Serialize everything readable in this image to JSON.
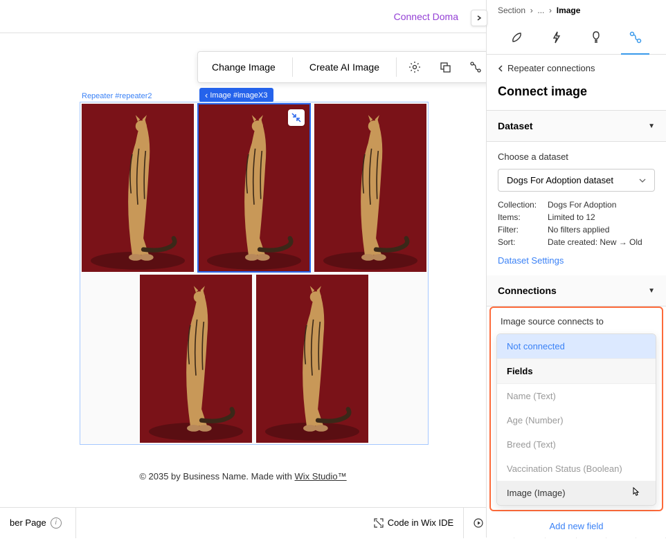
{
  "header": {
    "connect_domain": "Connect Doma"
  },
  "toolbar": {
    "change_image": "Change Image",
    "create_ai_image": "Create AI Image"
  },
  "canvas": {
    "repeater_label": "Repeater #repeater2",
    "image_tag": "Image #imageX3"
  },
  "footer": {
    "prefix": "© 2035 by Business Name. Made with ",
    "link": "Wix Studio™"
  },
  "bottom": {
    "page": "ber Page",
    "code_ide": "Code in Wix IDE",
    "run": "Run"
  },
  "panel": {
    "breadcrumb": {
      "a": "Section",
      "sep": "›",
      "mid": "...",
      "current": "Image"
    },
    "back": "Repeater connections",
    "title": "Connect image",
    "dataset_header": "Dataset",
    "choose_dataset": "Choose a dataset",
    "dataset_value": "Dogs For Adoption dataset",
    "meta": {
      "collection_k": "Collection:",
      "collection_v": "Dogs For Adoption",
      "items_k": "Items:",
      "items_v": "Limited to 12",
      "filter_k": "Filter:",
      "filter_v": "No filters applied",
      "sort_k": "Sort:",
      "sort_v": "Date created: New → Old"
    },
    "dataset_settings": "Dataset Settings",
    "connections_header": "Connections",
    "image_connects": "Image source connects to",
    "not_connected": "Not connected",
    "fields_header": "Fields",
    "fields": {
      "name": "Name (Text)",
      "age": "Age (Number)",
      "breed": "Breed (Text)",
      "vacc": "Vaccination Status (Boolean)",
      "image": "Image (Image)"
    },
    "add_field": "Add new field"
  }
}
